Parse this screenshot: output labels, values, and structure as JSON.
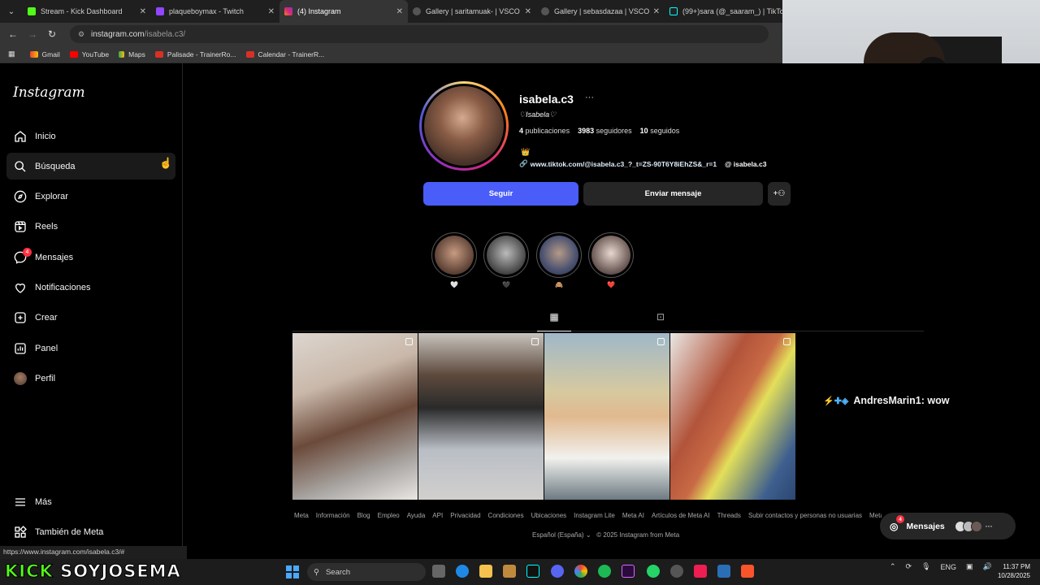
{
  "browser": {
    "tabs": [
      {
        "label": "Stream - Kick Dashboard",
        "color": "#53fc18"
      },
      {
        "label": "plaqueboymax - Twitch",
        "color": "#9146ff"
      },
      {
        "label": "(4) Instagram",
        "color": "#e1306c"
      },
      {
        "label": "Gallery | saritamuak- | VSCO",
        "color": "#444444"
      },
      {
        "label": "Gallery | sebasdazaa | VSCO",
        "color": "#444444"
      },
      {
        "label": "(99+)sara (@_saaram_) | TikTok",
        "color": "#222222"
      }
    ],
    "url_host": "instagram.com",
    "url_path": "/isabela.c3/",
    "bookmarks": [
      "Gmail",
      "YouTube",
      "Maps",
      "Palisade - TrainerRo...",
      "Calendar - TrainerR..."
    ],
    "status_url": "https://www.instagram.com/isabela.c3/#"
  },
  "sidebar": {
    "logo": "Instagram",
    "items": [
      {
        "label": "Inicio",
        "icon": "home-icon"
      },
      {
        "label": "Búsqueda",
        "icon": "search-icon"
      },
      {
        "label": "Explorar",
        "icon": "compass-icon"
      },
      {
        "label": "Reels",
        "icon": "reels-icon"
      },
      {
        "label": "Mensajes",
        "icon": "messenger-icon",
        "badge": "4"
      },
      {
        "label": "Notificaciones",
        "icon": "heart-icon"
      },
      {
        "label": "Crear",
        "icon": "plus-icon"
      },
      {
        "label": "Panel",
        "icon": "chart-icon"
      },
      {
        "label": "Perfil",
        "icon": "avatar"
      }
    ],
    "bottom": [
      {
        "label": "Más",
        "icon": "menu-icon"
      },
      {
        "label": "También de Meta",
        "icon": "meta-icon"
      }
    ]
  },
  "profile": {
    "username": "isabela.c3",
    "fullname": "♡Isabela♡",
    "posts_count": "4",
    "posts_label": "publicaciones",
    "followers_count": "3983",
    "followers_label": "seguidores",
    "following_count": "10",
    "following_label": "seguidos",
    "bio_emoji": "👑",
    "link": "www.tiktok.com/@isabela.c3_?_t=ZS-90T6Y8iEhZS&_r=1",
    "threads": "isabela.c3",
    "follow_btn": "Seguir",
    "message_btn": "Enviar mensaje"
  },
  "highlights": [
    {
      "label": "🤍"
    },
    {
      "label": "🖤"
    },
    {
      "label": "🙈"
    },
    {
      "label": "❤️"
    }
  ],
  "chat": {
    "emotes": "⚡✚◈",
    "user": "AndresMarin1",
    "message": " : wow"
  },
  "footer": {
    "links": [
      "Meta",
      "Información",
      "Blog",
      "Empleo",
      "Ayuda",
      "API",
      "Privacidad",
      "Condiciones",
      "Ubicaciones",
      "Instagram Lite",
      "Meta AI",
      "Artículos de Meta AI",
      "Threads",
      "Subir contactos y personas no usuarias",
      "Meta"
    ],
    "language": "Español (España) ⌄",
    "copyright": "© 2025 Instagram from Meta"
  },
  "messages_pill": {
    "label": "Mensajes",
    "badge": "4"
  },
  "overlay": {
    "kick_prefix": "KICK",
    "kick_name": "SOYJOSEMA"
  },
  "taskbar": {
    "search": "Search",
    "lang": "ENG",
    "time": "11:37 PM",
    "date": "10/28/2025"
  }
}
